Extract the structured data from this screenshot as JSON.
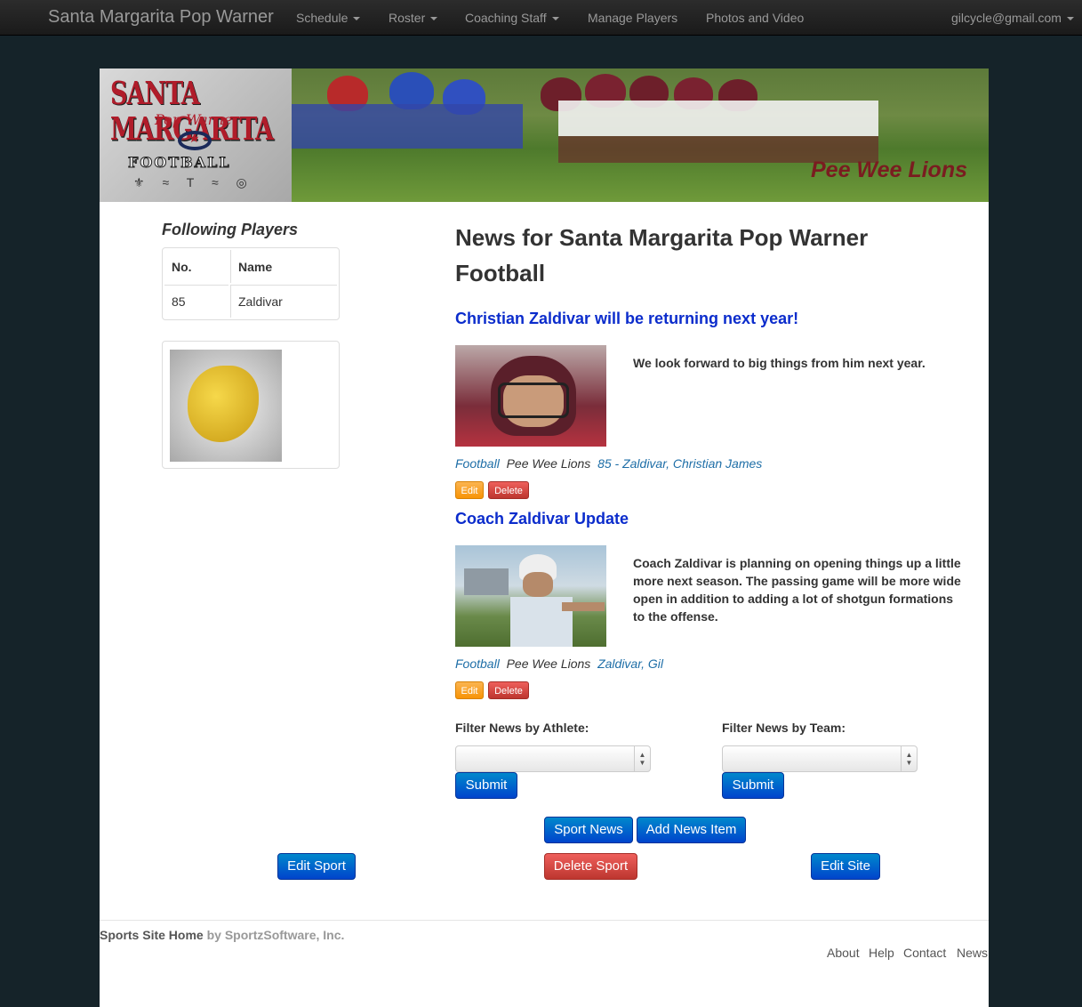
{
  "navbar": {
    "brand": "Santa Margarita Pop Warner",
    "items": [
      "Schedule",
      "Roster",
      "Coaching Staff",
      "Manage Players",
      "Photos and Video"
    ],
    "user": "gilcycle@gmail.com"
  },
  "banner": {
    "logo_line1": "SANTA MARGARITA",
    "logo_line2": "Pop Warner",
    "logo_line3": "FOOTBALL",
    "team_name": "Pee Wee Lions"
  },
  "sidebar": {
    "title": "Following Players",
    "table": {
      "headers": [
        "No.",
        "Name"
      ],
      "rows": [
        [
          "85",
          "Zaldivar"
        ]
      ]
    }
  },
  "main": {
    "heading": "News for Santa Margarita Pop Warner Football",
    "posts": [
      {
        "title": "Christian Zaldivar will be returning next year!",
        "body": "We look forward to big things from him next year.",
        "tag_sport": "Football",
        "tag_team": "Pee Wee Lions",
        "tag_player": "85 - Zaldivar",
        "tag_player_sep": ",",
        "tag_player2": "Christian James",
        "edit": "Edit",
        "delete": "Delete"
      },
      {
        "title": "Coach Zaldivar Update",
        "body": "Coach Zaldivar is planning on opening things up a little more next season. The passing game will be more wide open in addition to adding a lot of shotgun formations to the offense.",
        "tag_sport": "Football",
        "tag_team": "Pee Wee Lions",
        "tag_player": "Zaldivar, Gil",
        "edit": "Edit",
        "delete": "Delete"
      }
    ],
    "filters": {
      "athlete_label": "Filter News by Athlete:",
      "team_label": "Filter News by Team:",
      "athlete_value": "",
      "team_value": "",
      "submit": "Submit"
    },
    "buttons": {
      "sport_news": "Sport News",
      "add_news": "Add News Item",
      "edit_sport": "Edit Sport",
      "delete_sport": "Delete Sport",
      "edit_site": "Edit Site"
    }
  },
  "footer": {
    "home": "Sports Site Home",
    "by": "by SportzSoftware, Inc.",
    "links": [
      "About",
      "Help",
      "Contact",
      "News"
    ]
  },
  "colors": {
    "page_bg": "#152329",
    "post_title": "#0b2ccc",
    "link": "#1e6ea7",
    "primary": "#0044cc",
    "danger": "#bd362f",
    "warning": "#f89406"
  }
}
